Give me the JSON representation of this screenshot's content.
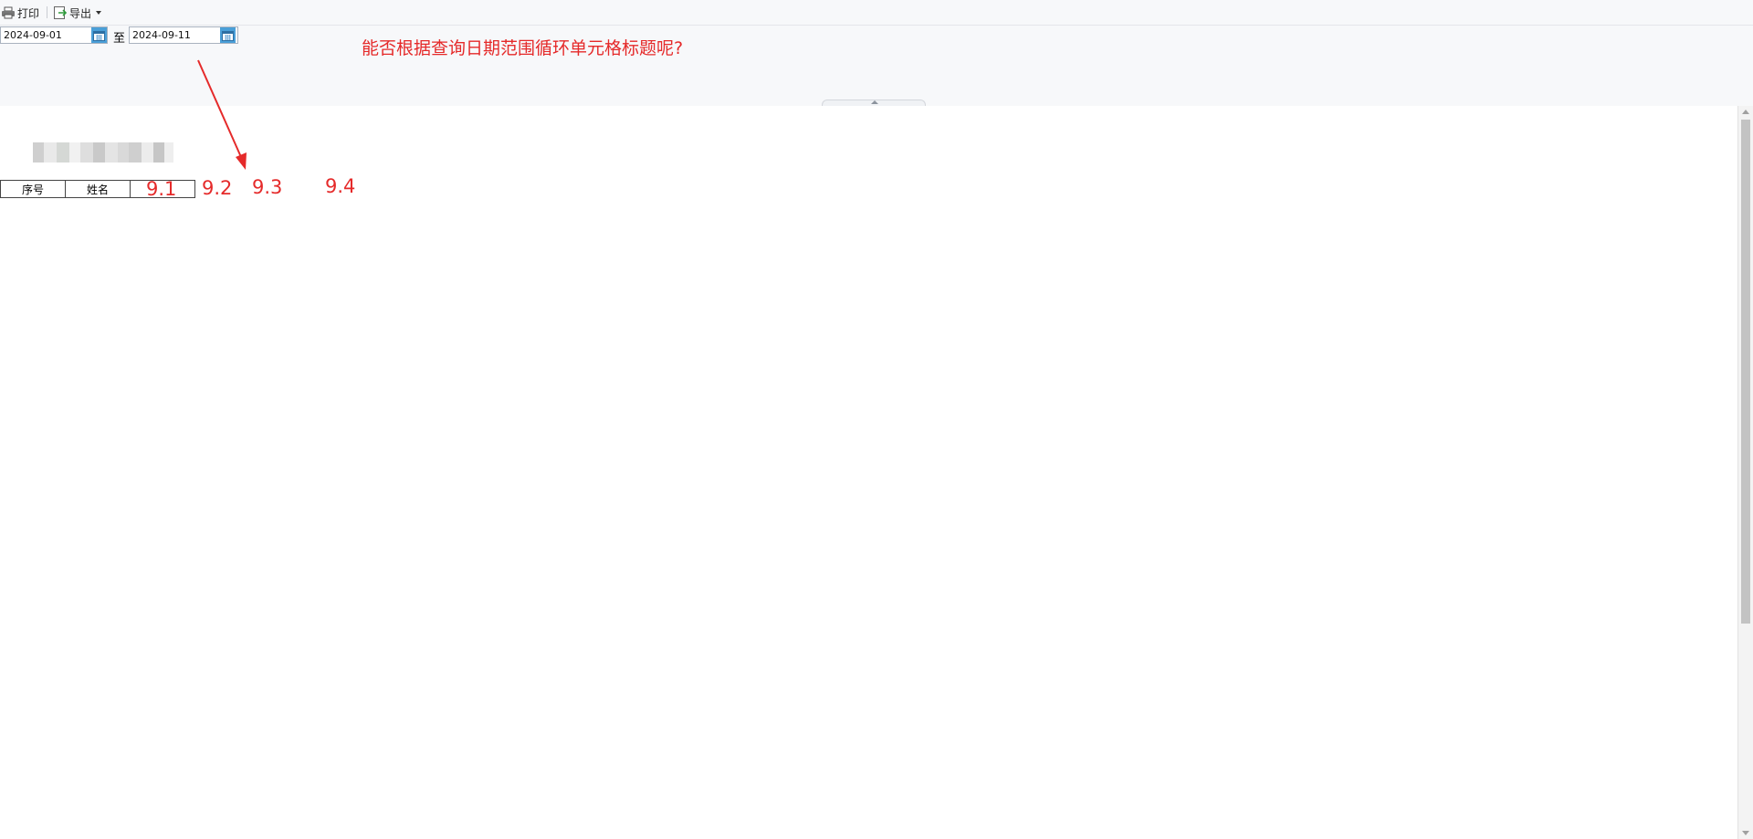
{
  "toolbar": {
    "print_label": "打印",
    "export_label": "导出"
  },
  "query": {
    "start_date": "2024-09-01",
    "date_separator": "至",
    "end_date": "2024-09-11"
  },
  "annotation": {
    "question": "能否根据查询日期范围循环单元格标题呢?",
    "column_labels": [
      "9.1",
      "9.2",
      "9.3",
      "9.4"
    ],
    "color": "#e52a2a"
  },
  "report": {
    "headers": [
      "序号",
      "姓名"
    ]
  },
  "icons": {
    "print": "printer-icon",
    "export": "export-icon",
    "dropdown": "caret-down-icon",
    "calendar": "calendar-icon"
  }
}
